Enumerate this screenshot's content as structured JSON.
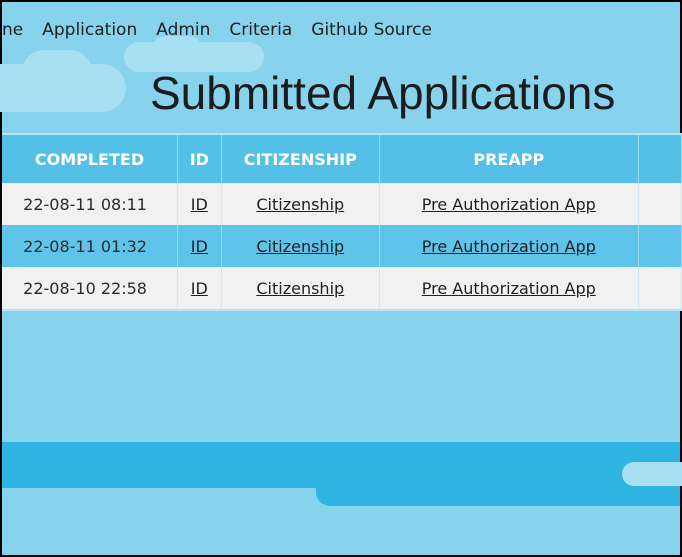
{
  "nav": {
    "items": [
      "ne",
      "Application",
      "Admin",
      "Criteria",
      "Github Source"
    ]
  },
  "page": {
    "title": "Submitted Applications"
  },
  "table": {
    "headers": [
      "COMPLETED",
      "ID",
      "CITIZENSHIP",
      "PREAPP",
      ""
    ],
    "rows": [
      {
        "completed": "22-08-11 08:11",
        "id": "ID",
        "citizenship": "Citizenship",
        "preapp": "Pre Authorization App"
      },
      {
        "completed": "22-08-11 01:32",
        "id": "ID",
        "citizenship": "Citizenship",
        "preapp": "Pre Authorization App"
      },
      {
        "completed": "22-08-10 22:58",
        "id": "ID",
        "citizenship": "Citizenship",
        "preapp": "Pre Authorization App"
      }
    ]
  },
  "colors": {
    "background": "#87d2ec",
    "header": "#55c0e7",
    "row_alt": "#5ec4ea",
    "row_light": "#f1f1f1",
    "band": "#2fb3e0"
  }
}
